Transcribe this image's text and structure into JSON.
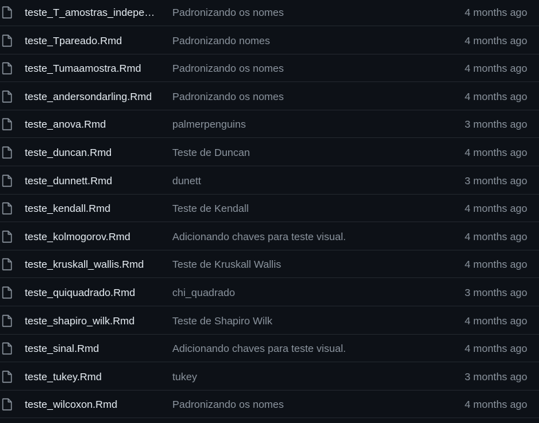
{
  "colors": {
    "background": "#0d1117",
    "row_border": "#21262d",
    "file_name": "#e6edf3",
    "muted_text": "#8b949e",
    "icon": "#8b949e"
  },
  "icons": {
    "file": "file-icon"
  },
  "files": [
    {
      "name": "teste_T_amostras_indepen...",
      "message": "Padronizando os nomes",
      "time": "4 months ago"
    },
    {
      "name": "teste_Tpareado.Rmd",
      "message": "Padronizando nomes",
      "time": "4 months ago"
    },
    {
      "name": "teste_Tumaamostra.Rmd",
      "message": "Padronizando os nomes",
      "time": "4 months ago"
    },
    {
      "name": "teste_andersondarling.Rmd",
      "message": "Padronizando os nomes",
      "time": "4 months ago"
    },
    {
      "name": "teste_anova.Rmd",
      "message": "palmerpenguins",
      "time": "3 months ago"
    },
    {
      "name": "teste_duncan.Rmd",
      "message": "Teste de Duncan",
      "time": "4 months ago"
    },
    {
      "name": "teste_dunnett.Rmd",
      "message": "dunett",
      "time": "3 months ago"
    },
    {
      "name": "teste_kendall.Rmd",
      "message": "Teste de Kendall",
      "time": "4 months ago"
    },
    {
      "name": "teste_kolmogorov.Rmd",
      "message": "Adicionando chaves para teste visual.",
      "time": "4 months ago"
    },
    {
      "name": "teste_kruskall_wallis.Rmd",
      "message": "Teste de Kruskall Wallis",
      "time": "4 months ago"
    },
    {
      "name": "teste_quiquadrado.Rmd",
      "message": "chi_quadrado",
      "time": "3 months ago"
    },
    {
      "name": "teste_shapiro_wilk.Rmd",
      "message": "Teste de Shapiro Wilk",
      "time": "4 months ago"
    },
    {
      "name": "teste_sinal.Rmd",
      "message": "Adicionando chaves para teste visual.",
      "time": "4 months ago"
    },
    {
      "name": "teste_tukey.Rmd",
      "message": "tukey",
      "time": "3 months ago"
    },
    {
      "name": "teste_wilcoxon.Rmd",
      "message": "Padronizando os nomes",
      "time": "4 months ago"
    }
  ]
}
